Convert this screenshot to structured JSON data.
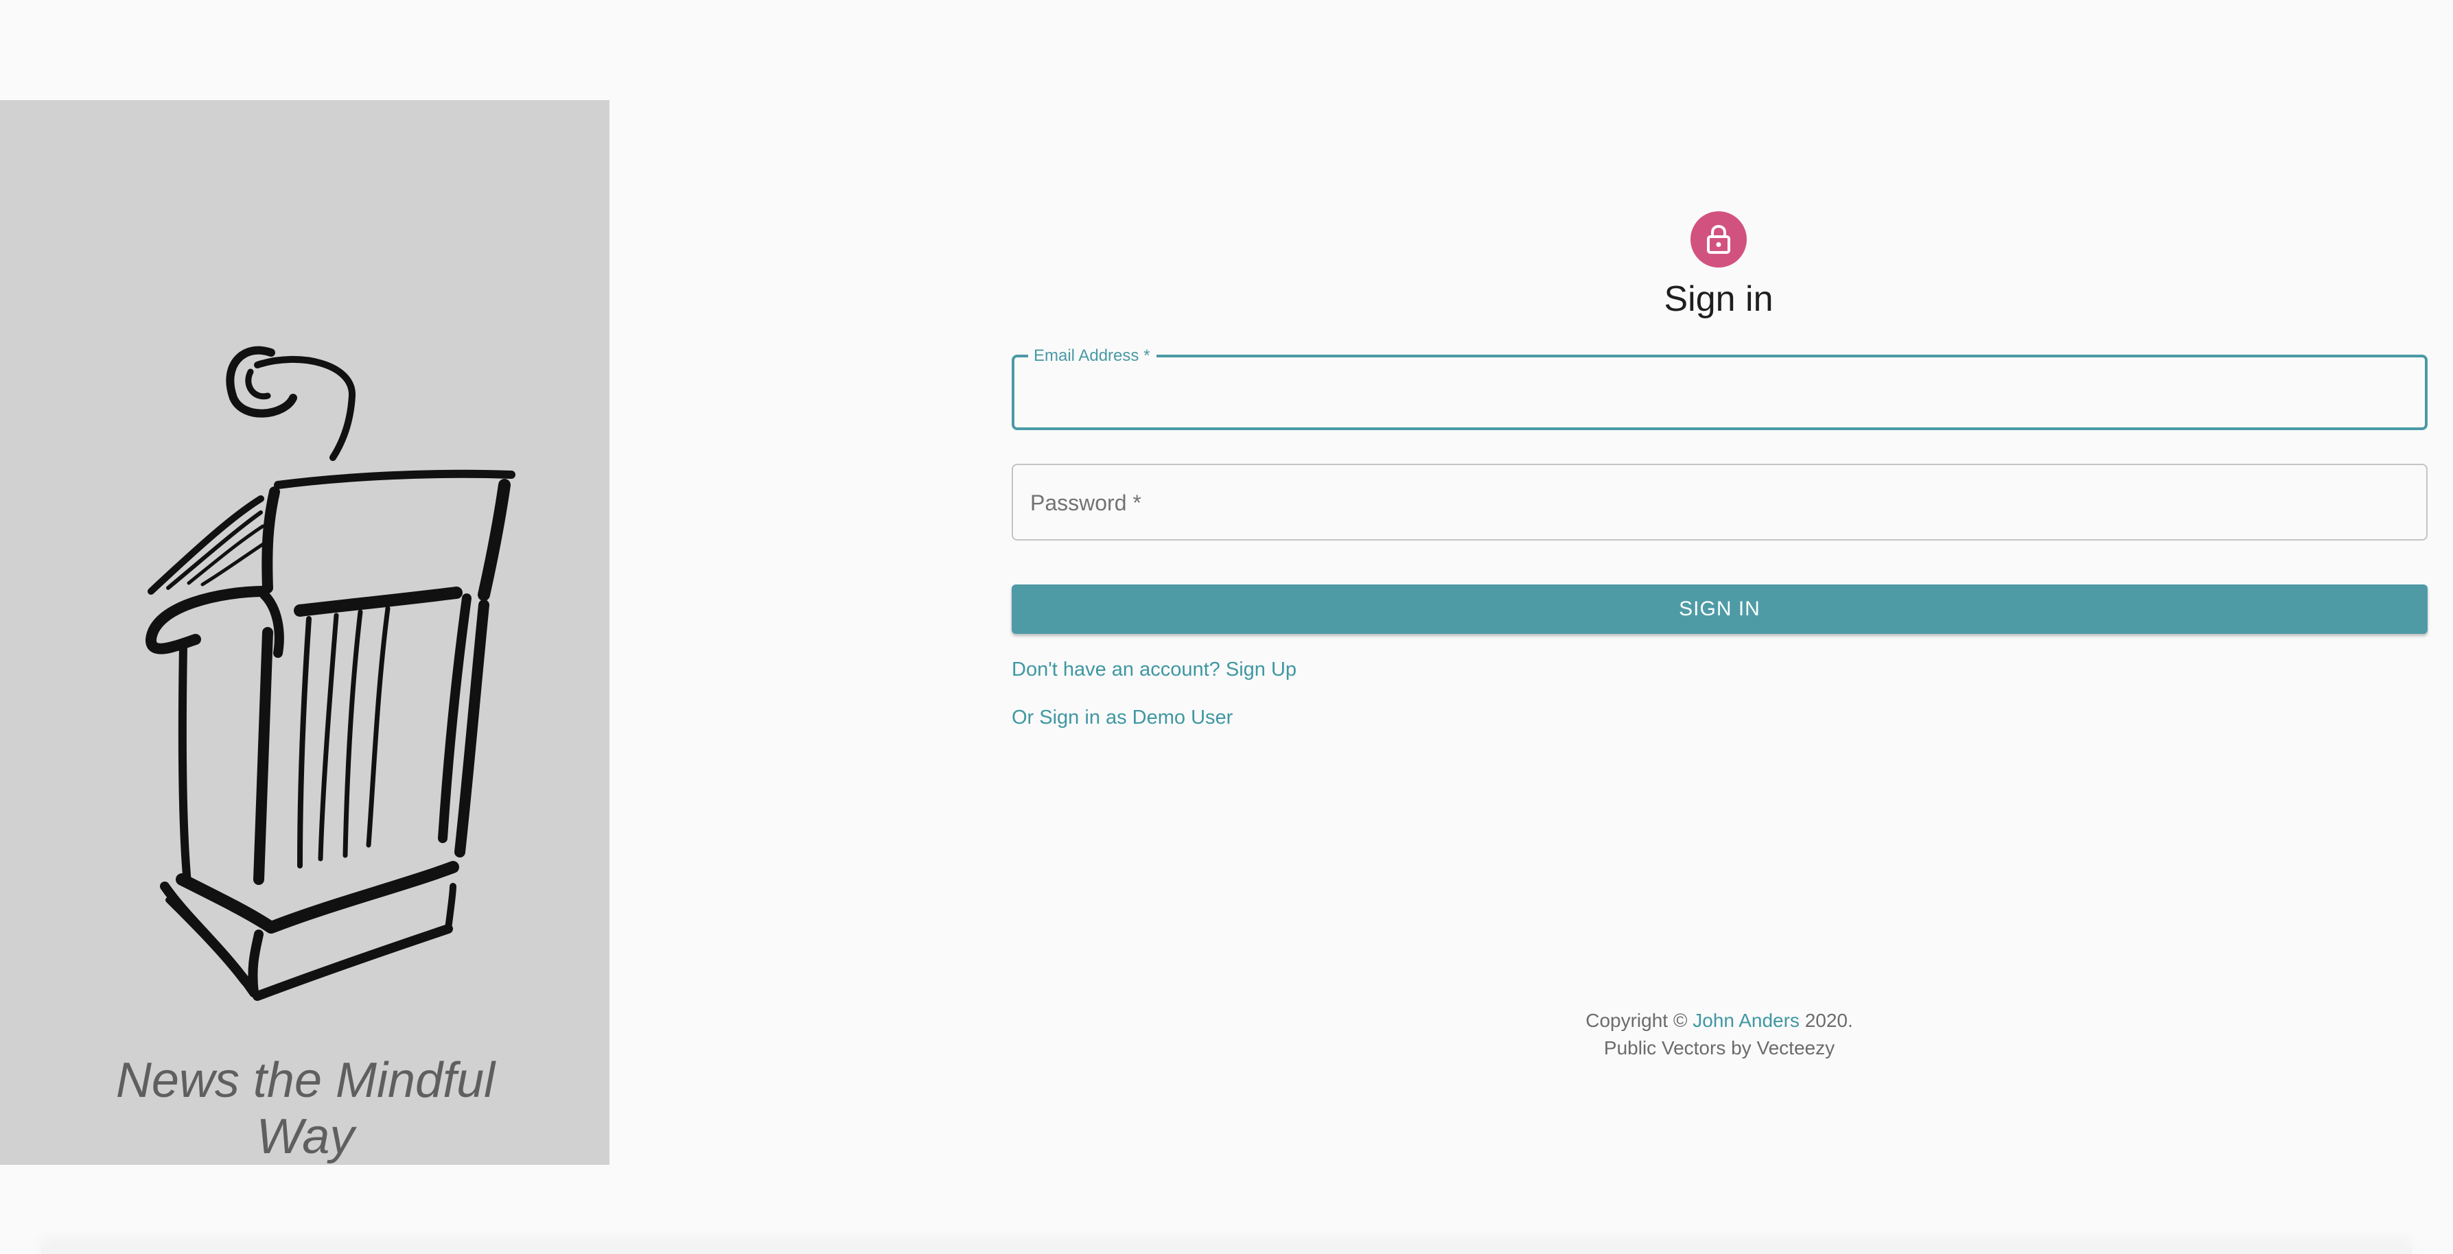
{
  "branding": {
    "tagline": "News the Mindful Way",
    "illustration": "podium-icon"
  },
  "auth": {
    "icon": "lock-icon",
    "accent_color": "#d2527f",
    "title": "Sign in",
    "email": {
      "label": "Email Address",
      "required_mark": "*",
      "value": ""
    },
    "password": {
      "label": "Password",
      "required_mark": "*",
      "value": ""
    },
    "submit_label": "SIGN IN",
    "primary_color": "#4e9ba6",
    "signup_link": "Don't have an account? Sign Up",
    "demo_link": "Or Sign in as Demo User"
  },
  "footer": {
    "copyright_prefix": "Copyright ©",
    "author": "John Anders",
    "year_suffix": "2020.",
    "credits": "Public Vectors by Vecteezy"
  }
}
